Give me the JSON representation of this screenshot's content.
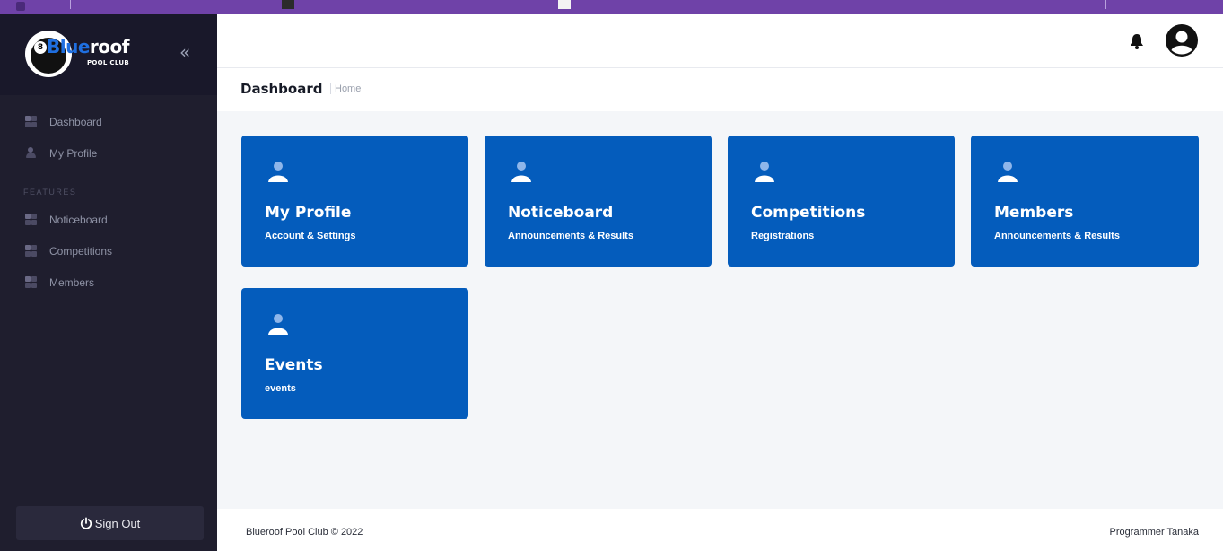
{
  "brand": {
    "logo_text_blue": "Blue",
    "logo_text_white": "roof",
    "logo_sub": "POOL CLUB",
    "collapse_symbol": "«"
  },
  "sidebar": {
    "items": [
      {
        "label": "Dashboard",
        "icon": "grid-icon"
      },
      {
        "label": "My Profile",
        "icon": "user-icon"
      }
    ],
    "section_label": "FEATURES",
    "feature_items": [
      {
        "label": "Noticeboard",
        "icon": "grid-icon"
      },
      {
        "label": "Competitions",
        "icon": "grid-icon"
      },
      {
        "label": "Members",
        "icon": "grid-icon"
      }
    ],
    "signout_label": "Sign Out"
  },
  "header": {
    "page_title": "Dashboard",
    "breadcrumb": "Home"
  },
  "cards": [
    {
      "title": "My Profile",
      "subtitle": "Account & Settings",
      "icon": "user-icon"
    },
    {
      "title": "Noticeboard",
      "subtitle": "Announcements & Results",
      "icon": "user-icon"
    },
    {
      "title": "Competitions",
      "subtitle": "Registrations",
      "icon": "user-icon"
    },
    {
      "title": "Members",
      "subtitle": "Announcements & Results",
      "icon": "user-icon"
    },
    {
      "title": "Events",
      "subtitle": "events",
      "icon": "user-icon"
    }
  ],
  "footer": {
    "left": "Blueroof Pool Club © 2022",
    "right": "Programmer Tanaka"
  },
  "colors": {
    "sidebar_bg": "#1f1e2e",
    "card_bg": "#045cbc",
    "accent_purple": "#6f42a8",
    "page_bg": "#f4f6f9"
  }
}
